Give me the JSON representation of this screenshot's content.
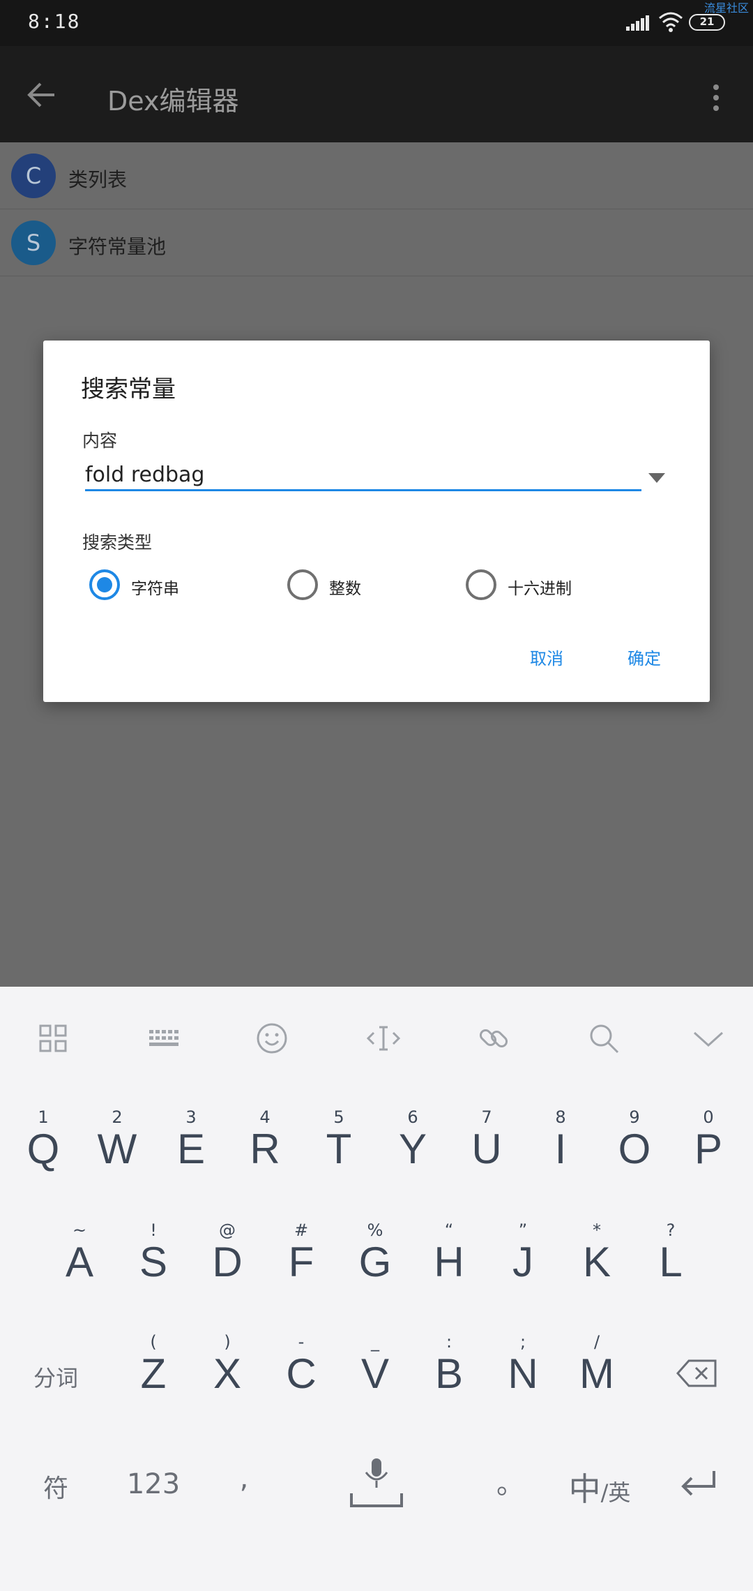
{
  "status_bar": {
    "time": "8:18",
    "watermark": "流星社区",
    "battery": "21"
  },
  "app_bar": {
    "title": "Dex编辑器"
  },
  "list": {
    "items": [
      {
        "badge": "C",
        "label": "类列表",
        "color": "#23407a"
      },
      {
        "badge": "S",
        "label": "字符常量池",
        "color": "#1a5b8a"
      }
    ]
  },
  "dialog": {
    "title": "搜索常量",
    "content_label": "内容",
    "input_value": "fold redbag",
    "search_type_label": "搜索类型",
    "options": [
      {
        "label": "字符串",
        "checked": true
      },
      {
        "label": "整数",
        "checked": false
      },
      {
        "label": "十六进制",
        "checked": false
      }
    ],
    "cancel_label": "取消",
    "ok_label": "确定",
    "accent_color": "#1e88e5"
  },
  "keyboard": {
    "toolbar_icons": [
      "grid-icon",
      "keyboard-icon",
      "emoji-icon",
      "cursor-icon",
      "link-icon",
      "search-icon",
      "collapse-icon"
    ],
    "row1": {
      "hints": [
        "1",
        "2",
        "3",
        "4",
        "5",
        "6",
        "7",
        "8",
        "9",
        "0"
      ],
      "keys": [
        "Q",
        "W",
        "E",
        "R",
        "T",
        "Y",
        "U",
        "I",
        "O",
        "P"
      ]
    },
    "row2": {
      "hints": [
        "~",
        "!",
        "@",
        "#",
        "%",
        "“",
        "”",
        "*",
        "?"
      ],
      "keys": [
        "A",
        "S",
        "D",
        "F",
        "G",
        "H",
        "J",
        "K",
        "L"
      ]
    },
    "row3": {
      "hints": [
        "(",
        ")",
        "-",
        "_",
        ":",
        ";",
        "/"
      ],
      "keys": [
        "Z",
        "X",
        "C",
        "V",
        "B",
        "N",
        "M"
      ]
    },
    "segment_label": "分词",
    "symbol_label": "符",
    "num_label": "123",
    "comma_label": ",",
    "period_label": "。",
    "lang_main": "中",
    "lang_sub": "/英"
  }
}
